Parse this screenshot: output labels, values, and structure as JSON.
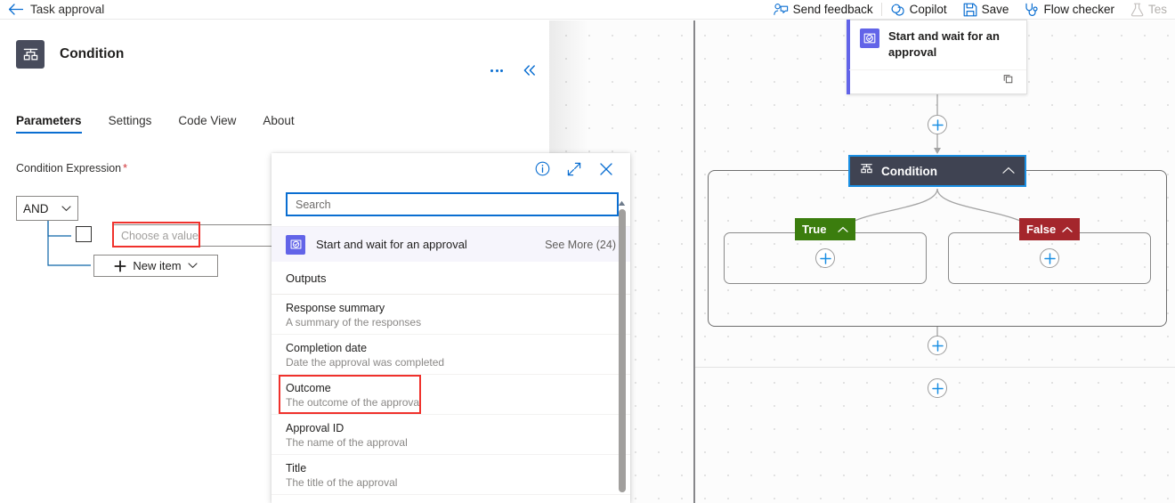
{
  "topbar": {
    "back_icon": "back-arrow-icon",
    "flow_title": "Task approval",
    "actions": [
      {
        "label": "Send feedback",
        "icon": "person-feedback-icon",
        "disabled": false
      },
      {
        "label": "Copilot",
        "icon": "copilot-icon",
        "disabled": false
      },
      {
        "label": "Save",
        "icon": "save-disk-icon",
        "disabled": false
      },
      {
        "label": "Flow checker",
        "icon": "stethoscope-icon",
        "disabled": false
      },
      {
        "label": "Tes",
        "icon": "flask-test-icon",
        "disabled": true
      }
    ]
  },
  "left_panel": {
    "node_icon": "condition-branch-icon",
    "node_title": "Condition",
    "more_menu": "ellipsis-menu",
    "collapse": "double-chevron-left-icon",
    "tabs": [
      {
        "label": "Parameters",
        "active": true
      },
      {
        "label": "Settings",
        "active": false
      },
      {
        "label": "Code View",
        "active": false
      },
      {
        "label": "About",
        "active": false
      }
    ],
    "field_label": "Condition Expression",
    "required_marker": "*",
    "logic_operator": "AND",
    "value_placeholder": "Choose a value",
    "new_item_label": "New item",
    "highlight_color": "#f0312c"
  },
  "dynamic_panel": {
    "info_icon": "info-circle-icon",
    "expand_icon": "expand-diagonal-icon",
    "close_icon": "close-x-icon",
    "search_placeholder": "Search",
    "source": {
      "icon": "approval-clock-icon",
      "name": "Start and wait for an approval",
      "see_more": "See More (24)"
    },
    "section_title": "Outputs",
    "items": [
      {
        "title": "Response summary",
        "desc": "A summary of the responses",
        "highlighted": false
      },
      {
        "title": "Completion date",
        "desc": "Date the approval was completed",
        "highlighted": false
      },
      {
        "title": "Outcome",
        "desc": "The outcome of the approval",
        "highlighted": true
      },
      {
        "title": "Approval ID",
        "desc": "The name of the approval",
        "highlighted": false
      },
      {
        "title": "Title",
        "desc": "The title of the approval",
        "highlighted": false
      }
    ]
  },
  "canvas": {
    "approval_card": {
      "icon": "approval-clock-icon",
      "title": "Start and wait for an approval",
      "footer_icon": "copy-pages-icon"
    },
    "condition_node": {
      "icon": "condition-branch-icon",
      "label": "Condition",
      "collapse_icon": "chevron-up-icon",
      "selected": true,
      "selection_color": "#1a8fe3",
      "background": "#3f4352"
    },
    "branches": [
      {
        "label": "True",
        "color": "#3b7d0e",
        "chevron": "chevron-up-icon",
        "add_icon": "plus-circle-icon"
      },
      {
        "label": "False",
        "color": "#a4262c",
        "chevron": "chevron-up-icon",
        "add_icon": "plus-circle-icon"
      }
    ],
    "add_buttons": [
      "plus-above-condition",
      "plus-true-branch",
      "plus-false-branch",
      "plus-after-scope",
      "plus-flow-end"
    ]
  }
}
